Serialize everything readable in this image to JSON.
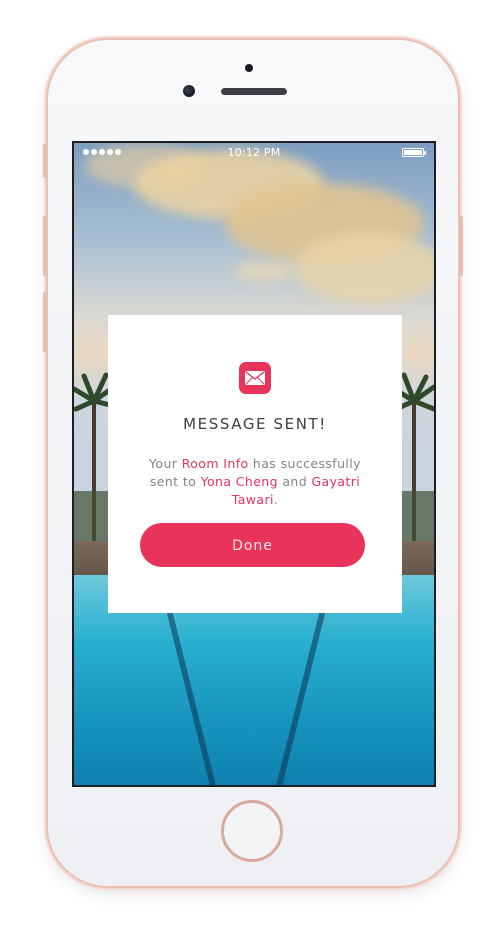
{
  "status_bar": {
    "time": "10:12 PM",
    "signal_dots": 5
  },
  "dialog": {
    "icon": "mail-icon",
    "title": "MESSAGE SENT!",
    "message": {
      "prefix": "Your ",
      "item": "Room Info",
      "middle": " has successfully sent to ",
      "recipient_1": "Yona Cheng",
      "joiner": " and ",
      "recipient_2": "Gayatri Tawari",
      "suffix": "."
    },
    "done_label": "Done"
  },
  "colors": {
    "accent": "#e8345a",
    "title_text": "#3b3f4a",
    "body_text": "#80858f",
    "phone_trim": "#e9c1b4"
  }
}
